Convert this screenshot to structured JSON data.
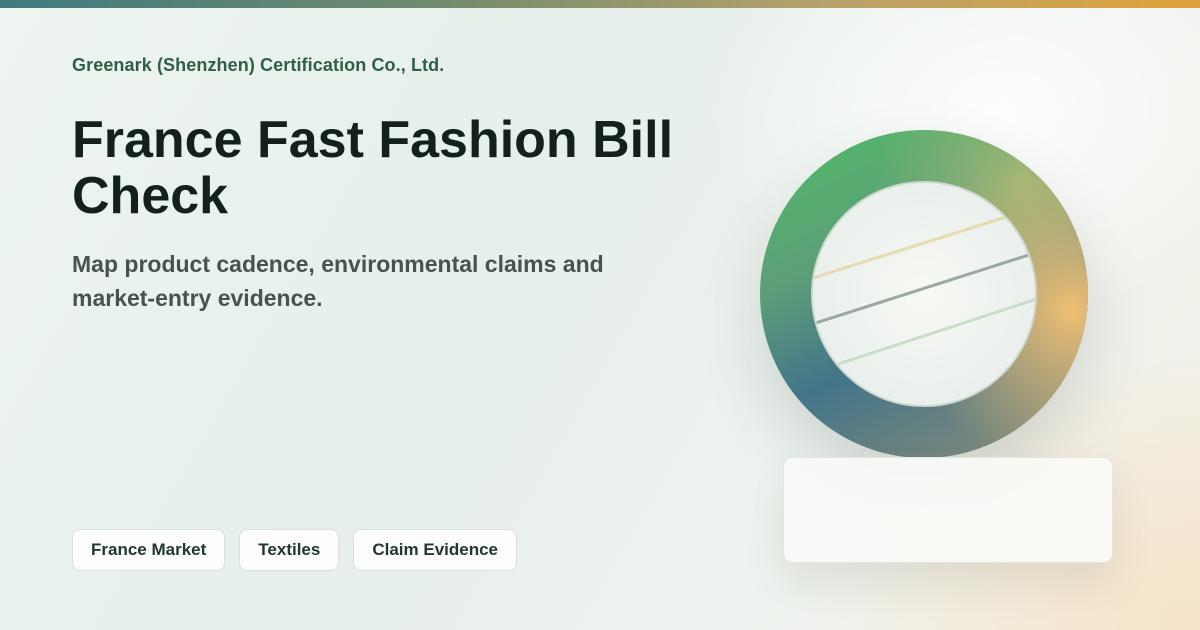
{
  "header": {
    "company": "Greenark (Shenzhen) Certification Co., Ltd.",
    "title": "France Fast Fashion Bill Check",
    "subtitle": "Map product cadence, environmental claims and market-entry evidence."
  },
  "tags": [
    {
      "label": "France Market"
    },
    {
      "label": "Textiles"
    },
    {
      "label": "Claim Evidence"
    }
  ],
  "illustration": {
    "icon": "gradient-ring-emblem",
    "colors": {
      "green": "#55b56a",
      "blue": "#3e6f91",
      "gold": "#e6bc74",
      "olive": "#8fae72"
    }
  },
  "colors": {
    "accent": "#2f5f45",
    "title": "#13211a",
    "subtitle": "#47534d"
  }
}
